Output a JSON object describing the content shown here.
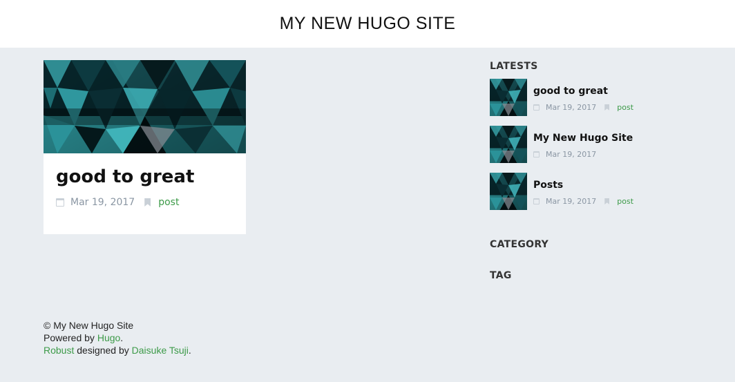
{
  "header": {
    "site_title": "MY NEW HUGO SITE"
  },
  "main": {
    "posts": [
      {
        "title": "good to great",
        "date": "Mar 19, 2017",
        "category": "post"
      }
    ]
  },
  "sidebar": {
    "latests_heading": "LATESTS",
    "latests": [
      {
        "title": "good to great",
        "date": "Mar 19, 2017",
        "category": "post"
      },
      {
        "title": "My New Hugo Site",
        "date": "Mar 19, 2017",
        "category": ""
      },
      {
        "title": "Posts",
        "date": "Mar 19, 2017",
        "category": "post"
      }
    ],
    "category_heading": "CATEGORY",
    "tag_heading": "TAG"
  },
  "footer": {
    "copyright": "© My New Hugo Site",
    "powered_prefix": "Powered by ",
    "powered_link": "Hugo",
    "powered_suffix": ".",
    "theme_link": "Robust",
    "designed_by": " designed by ",
    "author_link": "Daisuke Tsuji",
    "author_suffix": "."
  },
  "colors": {
    "background": "#e9edf1",
    "link_green": "#3c9a48",
    "meta_gray": "#8a96a3"
  },
  "icons": [
    "calendar-icon",
    "bookmark-icon"
  ]
}
